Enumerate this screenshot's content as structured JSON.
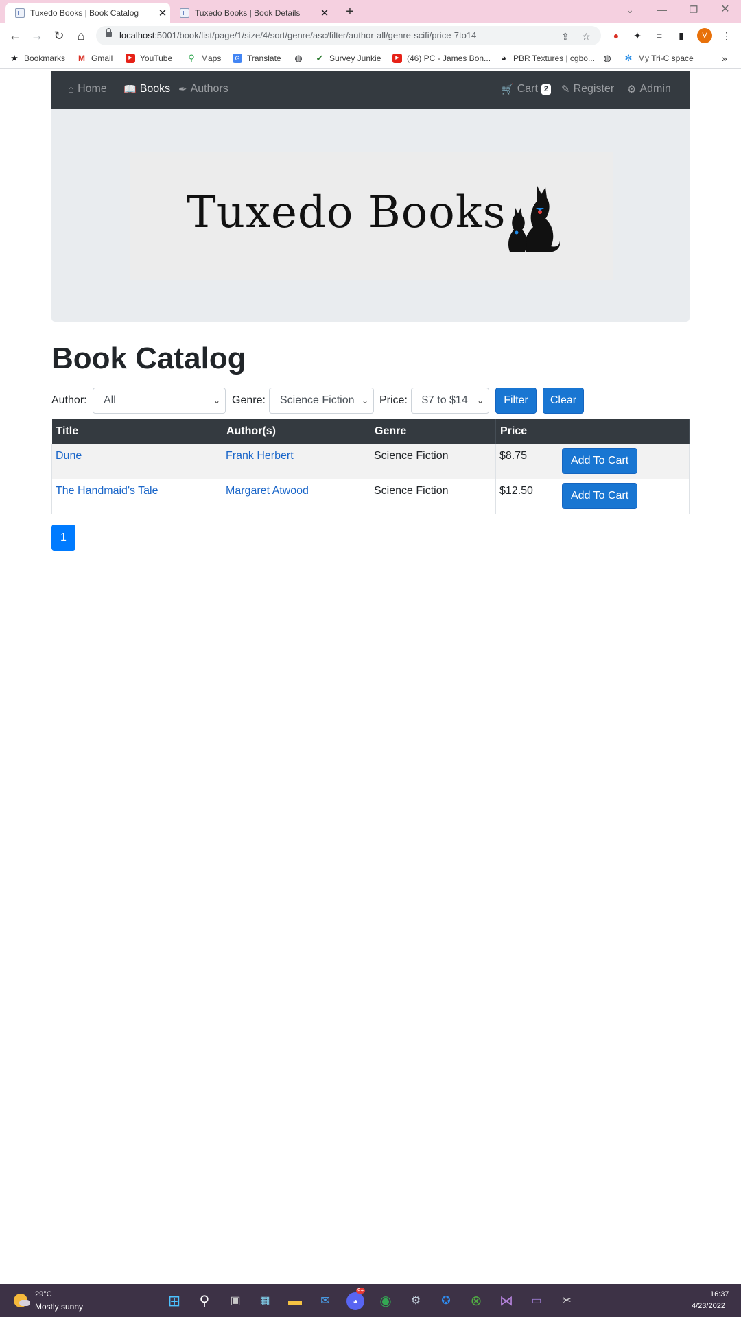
{
  "browser": {
    "tabs": [
      {
        "title": "Tuxedo Books | Book Catalog",
        "active": true
      },
      {
        "title": "Tuxedo Books | Book Details",
        "active": false
      }
    ],
    "url_host": "localhost",
    "url_rest": ":5001/book/list/page/1/size/4/sort/genre/asc/filter/author-all/genre-scifi/price-7to14",
    "profile_initial": "V",
    "bookmarks": [
      "Bookmarks",
      "Gmail",
      "YouTube",
      "Maps",
      "Translate",
      "Survey Junkie",
      "(46) PC - James Bon...",
      "PBR Textures | cgbo...",
      "My Tri-C space"
    ],
    "bookmarks_overflow": "»"
  },
  "site": {
    "nav_left": [
      "Home",
      "Books",
      "Authors"
    ],
    "nav_active": "Books",
    "cart_label": "Cart",
    "cart_count": "2",
    "register_label": "Register",
    "admin_label": "Admin",
    "logo_text": "Tuxedo Books"
  },
  "catalog": {
    "title": "Book Catalog",
    "filters": {
      "author_label": "Author:",
      "author_value": "All",
      "genre_label": "Genre:",
      "genre_value": "Science Fiction",
      "price_label": "Price:",
      "price_value": "$7 to $14",
      "filter_button": "Filter",
      "clear_button": "Clear"
    },
    "columns": [
      "Title",
      "Author(s)",
      "Genre",
      "Price",
      ""
    ],
    "rows": [
      {
        "title": "Dune",
        "author": "Frank Herbert",
        "genre": "Science Fiction",
        "price": "$8.75",
        "action": "Add To Cart"
      },
      {
        "title": "The Handmaid's Tale",
        "author": "Margaret Atwood",
        "genre": "Science Fiction",
        "price": "$12.50",
        "action": "Add To Cart"
      }
    ],
    "page": "1"
  },
  "taskbar": {
    "temperature": "29°C",
    "weather": "Mostly sunny",
    "time": "16:37",
    "date": "4/23/2022",
    "discord_badge": "9+"
  },
  "colors": {
    "navbar": "#343a40",
    "primary": "#1976d2",
    "pager": "#007bff",
    "link": "#1a66c9",
    "tabstrip": "#f5d0e0",
    "taskbar": "#3d3246"
  }
}
